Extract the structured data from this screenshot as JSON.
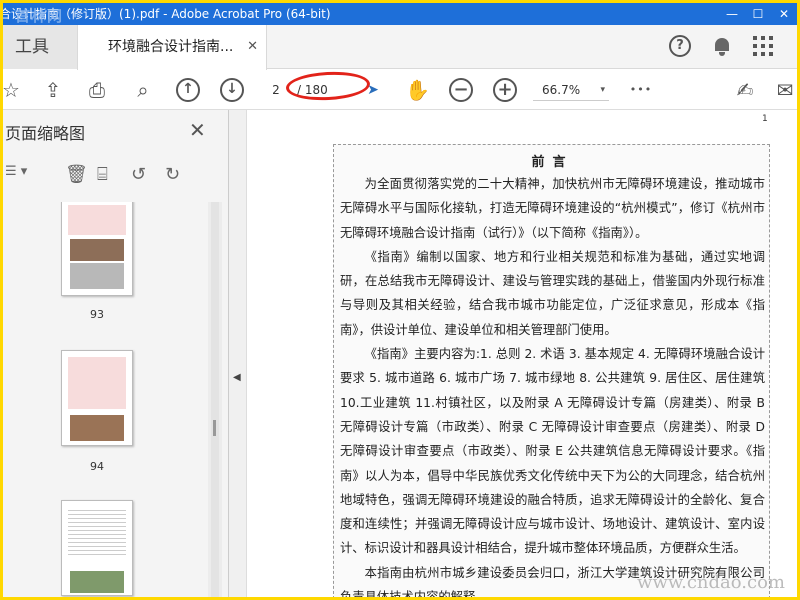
{
  "window": {
    "title": "合设计指南（修订版）(1).pdf - Adobe Acrobat Pro (64-bit)",
    "watermark": "首林网",
    "min": "—",
    "max": "☐",
    "close": "✕"
  },
  "tabs": {
    "tools_label": "工具",
    "doc_label": "环境融合设计指南...",
    "close_glyph": "✕"
  },
  "header_icons": {
    "help": "?",
    "help_icon": "help-icon",
    "bell_icon": "bell-icon",
    "apps_icon": "apps-grid-icon"
  },
  "toolbar": {
    "current_page": "2",
    "total_pages": "/ 180",
    "zoom": "66.7%",
    "zoom_caret": "▾",
    "star": "☆",
    "upload": "⇪",
    "print": "⎙",
    "search": "⌕",
    "prev": "↑",
    "next": "↓",
    "cursor": "➤",
    "hand": "✋",
    "zoom_out": "−",
    "zoom_in": "+",
    "more": "•••",
    "sign": "✍",
    "mail": "✉"
  },
  "sidebar": {
    "title": "页面缩略图",
    "close_glyph": "✕",
    "options_glyph": "☰ ▾",
    "delete_glyph": "🗑",
    "extract_glyph": "⌸",
    "undo_glyph": "↺",
    "redo_glyph": "↻",
    "thumbnails": [
      {
        "label": "93"
      },
      {
        "label": "94"
      },
      {
        "label": ""
      }
    ],
    "collapse_glyph": "◀"
  },
  "document": {
    "page_number": "1",
    "heading": "前言",
    "paragraphs": [
      "为全面贯彻落实党的二十大精神，加快杭州市无障碍环境建设，推动城市无障碍水平与国际化接轨，打造无障碍环境建设的“杭州模式”，修订《杭州市无障碍环境融合设计指南（试行）》（以下简称《指南》）。",
      "《指南》编制以国家、地方和行业相关规范和标准为基础，通过实地调研，在总结我市无障碍设计、建设与管理实践的基础上，借鉴国内外现行标准与导则及其相关经验，结合我市城市功能定位，广泛征求意见，形成本《指南》，供设计单位、建设单位和相关管理部门使用。",
      "《指南》主要内容为:1. 总则 2. 术语 3. 基本规定 4. 无障碍环境融合设计要求 5. 城市道路 6. 城市广场 7. 城市绿地 8. 公共建筑 9. 居住区、居住建筑 10.工业建筑 11.村镇社区，以及附录 A 无障碍设计专篇（房建类）、附录 B 无障碍设计专篇（市政类）、附录 C 无障碍设计审查要点（房建类）、附录 D 无障碍设计审查要点（市政类）、附录 E 公共建筑信息无障碍设计要求。《指南》以人为本，倡导中华民族优秀文化传统中天下为公的大同理念，结合杭州地域特色，强调无障碍环境建设的融合特质，追求无障碍设计的全龄化、复合度和连续性；并强调无障碍设计应与城市设计、场地设计、建筑设计、室内设计、标识设计和器具设计相结合，提升城市整体环境品质，方便群众生活。",
      "本指南由杭州市城乡建设委员会归口，浙江大学建筑设计研究院有限公司负责具体技术内容的解释。"
    ]
  },
  "site_watermark": "www.cndao.com",
  "colors": {
    "outer_border": "#ffd800",
    "titlebar": "#1e6fd9",
    "annotation": "#e2231a"
  }
}
